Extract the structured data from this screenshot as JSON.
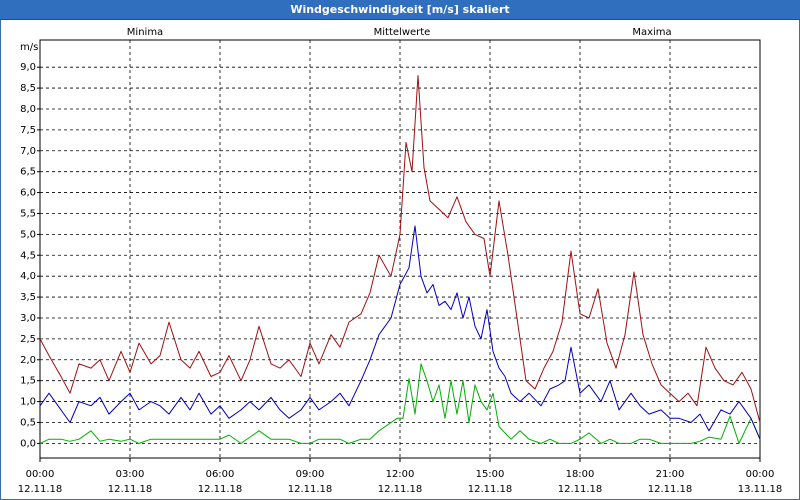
{
  "chart_data": {
    "type": "line",
    "title": "Windgeschwindigkeit [m/s] skaliert",
    "ylabel": "m/s",
    "ylim": [
      -0.35,
      9.65
    ],
    "grid": true,
    "y_ticks": [
      "0,0",
      "0,5",
      "1,0",
      "1,5",
      "2,0",
      "2,5",
      "3,0",
      "3,5",
      "4,0",
      "4,5",
      "5,0",
      "5,5",
      "6,0",
      "6,5",
      "7,0",
      "7,5",
      "8,0",
      "8,5",
      "9,0"
    ],
    "x_ticks": [
      {
        "time": "00:00",
        "date": "12.11.18"
      },
      {
        "time": "03:00",
        "date": "12.11.18"
      },
      {
        "time": "06:00",
        "date": "12.11.18"
      },
      {
        "time": "09:00",
        "date": "12.11.18"
      },
      {
        "time": "12:00",
        "date": "12.11.18"
      },
      {
        "time": "15:00",
        "date": "12.11.18"
      },
      {
        "time": "18:00",
        "date": "12.11.18"
      },
      {
        "time": "21:00",
        "date": "12.11.18"
      },
      {
        "time": "00:00",
        "date": "13.11.18"
      }
    ],
    "x_unit": "hours since 12.11.18 00:00",
    "legend_placement": "top",
    "colors": {
      "minima": "#00b000",
      "mittelwerte": "#0000c0",
      "maxima": "#a01010",
      "grid": "#000000",
      "title_bar": "#2f6fbd"
    },
    "series": [
      {
        "name": "Minima",
        "key": "minima",
        "color": "#00b000",
        "x": [
          0,
          0.3,
          0.7,
          1.0,
          1.3,
          1.7,
          2.0,
          2.3,
          2.7,
          3.0,
          3.3,
          3.7,
          4.0,
          4.3,
          4.7,
          5.0,
          5.3,
          5.7,
          6.0,
          6.3,
          6.7,
          7.0,
          7.3,
          7.7,
          8.0,
          8.3,
          8.7,
          9.0,
          9.3,
          9.7,
          10.0,
          10.3,
          10.7,
          11.0,
          11.3,
          11.7,
          11.9,
          12.1,
          12.3,
          12.5,
          12.7,
          12.9,
          13.1,
          13.3,
          13.5,
          13.7,
          13.9,
          14.1,
          14.3,
          14.5,
          14.7,
          14.9,
          15.1,
          15.3,
          15.7,
          16.0,
          16.3,
          16.7,
          17.0,
          17.3,
          17.7,
          18.0,
          18.3,
          18.7,
          19.0,
          19.3,
          19.7,
          20.0,
          20.3,
          20.7,
          21.0,
          21.3,
          21.7,
          22.0,
          22.3,
          22.7,
          23.0,
          23.3,
          23.7,
          24.0
        ],
        "y": [
          0.0,
          0.1,
          0.1,
          0.05,
          0.1,
          0.3,
          0.05,
          0.1,
          0.05,
          0.1,
          0.0,
          0.1,
          0.1,
          0.1,
          0.1,
          0.1,
          0.1,
          0.1,
          0.1,
          0.2,
          0.0,
          0.15,
          0.3,
          0.1,
          0.1,
          0.1,
          0.0,
          0.0,
          0.1,
          0.1,
          0.1,
          0.0,
          0.1,
          0.1,
          0.3,
          0.5,
          0.6,
          0.6,
          1.55,
          0.7,
          1.9,
          1.5,
          1.0,
          1.4,
          0.6,
          1.5,
          0.7,
          1.5,
          0.5,
          1.4,
          1.0,
          0.8,
          1.2,
          0.4,
          0.1,
          0.3,
          0.1,
          0.0,
          0.1,
          0.0,
          0.0,
          0.1,
          0.25,
          0.0,
          0.1,
          0.0,
          0.0,
          0.1,
          0.1,
          0.0,
          0.0,
          0.0,
          0.0,
          0.05,
          0.15,
          0.1,
          0.65,
          0.0,
          0.6,
          0.1
        ]
      },
      {
        "name": "Mittelwerte",
        "key": "mittelwerte",
        "color": "#0000c0",
        "x": [
          0,
          0.3,
          0.7,
          1.0,
          1.3,
          1.7,
          2.0,
          2.3,
          2.7,
          3.0,
          3.3,
          3.7,
          4.0,
          4.3,
          4.7,
          5.0,
          5.3,
          5.7,
          6.0,
          6.3,
          6.7,
          7.0,
          7.3,
          7.7,
          8.0,
          8.3,
          8.7,
          9.0,
          9.3,
          9.7,
          10.0,
          10.3,
          10.7,
          11.0,
          11.3,
          11.7,
          12.0,
          12.3,
          12.5,
          12.7,
          12.9,
          13.1,
          13.3,
          13.5,
          13.7,
          13.9,
          14.1,
          14.3,
          14.5,
          14.7,
          14.9,
          15.1,
          15.3,
          15.5,
          15.7,
          16.0,
          16.3,
          16.7,
          17.0,
          17.3,
          17.5,
          17.7,
          18.0,
          18.3,
          18.7,
          19.0,
          19.3,
          19.7,
          20.0,
          20.3,
          20.7,
          21.0,
          21.3,
          21.7,
          22.0,
          22.3,
          22.7,
          23.0,
          23.3,
          23.7,
          24.0
        ],
        "y": [
          0.9,
          1.2,
          0.8,
          0.5,
          1.0,
          0.9,
          1.1,
          0.7,
          1.0,
          1.2,
          0.8,
          1.0,
          0.9,
          0.7,
          1.1,
          0.8,
          1.2,
          0.7,
          0.9,
          0.6,
          0.8,
          1.0,
          0.8,
          1.1,
          0.8,
          0.6,
          0.8,
          1.1,
          0.8,
          1.0,
          1.2,
          0.9,
          1.5,
          2.0,
          2.6,
          3.0,
          3.8,
          4.2,
          5.2,
          4.0,
          3.6,
          3.8,
          3.3,
          3.4,
          3.2,
          3.6,
          3.0,
          3.5,
          2.8,
          2.5,
          3.2,
          2.2,
          1.8,
          1.6,
          1.2,
          1.0,
          1.2,
          0.9,
          1.3,
          1.4,
          1.5,
          2.3,
          1.2,
          1.4,
          1.0,
          1.5,
          0.8,
          1.2,
          0.9,
          0.7,
          0.8,
          0.6,
          0.6,
          0.5,
          0.7,
          0.3,
          0.8,
          0.7,
          1.0,
          0.6,
          0.1
        ]
      },
      {
        "name": "Maxima",
        "key": "maxima",
        "color": "#a01010",
        "x": [
          0,
          0.3,
          0.7,
          1.0,
          1.3,
          1.7,
          2.0,
          2.3,
          2.7,
          3.0,
          3.3,
          3.7,
          4.0,
          4.3,
          4.7,
          5.0,
          5.3,
          5.7,
          6.0,
          6.3,
          6.7,
          7.0,
          7.3,
          7.7,
          8.0,
          8.3,
          8.7,
          9.0,
          9.3,
          9.7,
          10.0,
          10.3,
          10.7,
          11.0,
          11.3,
          11.7,
          12.0,
          12.2,
          12.4,
          12.6,
          12.8,
          13.0,
          13.3,
          13.6,
          13.9,
          14.2,
          14.5,
          14.8,
          15.0,
          15.3,
          15.6,
          15.9,
          16.2,
          16.5,
          16.8,
          17.1,
          17.4,
          17.7,
          18.0,
          18.3,
          18.6,
          18.9,
          19.2,
          19.5,
          19.8,
          20.1,
          20.4,
          20.7,
          21.0,
          21.3,
          21.6,
          21.9,
          22.2,
          22.5,
          22.8,
          23.1,
          23.4,
          23.7,
          24.0
        ],
        "y": [
          2.5,
          2.1,
          1.6,
          1.2,
          1.9,
          1.8,
          2.0,
          1.5,
          2.2,
          1.7,
          2.4,
          1.9,
          2.1,
          2.9,
          2.0,
          1.8,
          2.2,
          1.6,
          1.7,
          2.1,
          1.5,
          2.0,
          2.8,
          1.9,
          1.8,
          2.0,
          1.6,
          2.4,
          1.9,
          2.6,
          2.3,
          2.9,
          3.1,
          3.6,
          4.5,
          4.0,
          5.0,
          7.2,
          6.5,
          8.8,
          6.6,
          5.8,
          5.6,
          5.4,
          5.9,
          5.3,
          5.0,
          4.9,
          4.0,
          5.8,
          4.5,
          3.0,
          1.5,
          1.3,
          1.8,
          2.2,
          2.9,
          4.6,
          3.1,
          3.0,
          3.7,
          2.4,
          1.8,
          2.6,
          4.1,
          2.6,
          1.9,
          1.4,
          1.2,
          1.0,
          1.2,
          0.9,
          2.3,
          1.8,
          1.5,
          1.4,
          1.7,
          1.3,
          0.5
        ]
      }
    ]
  }
}
